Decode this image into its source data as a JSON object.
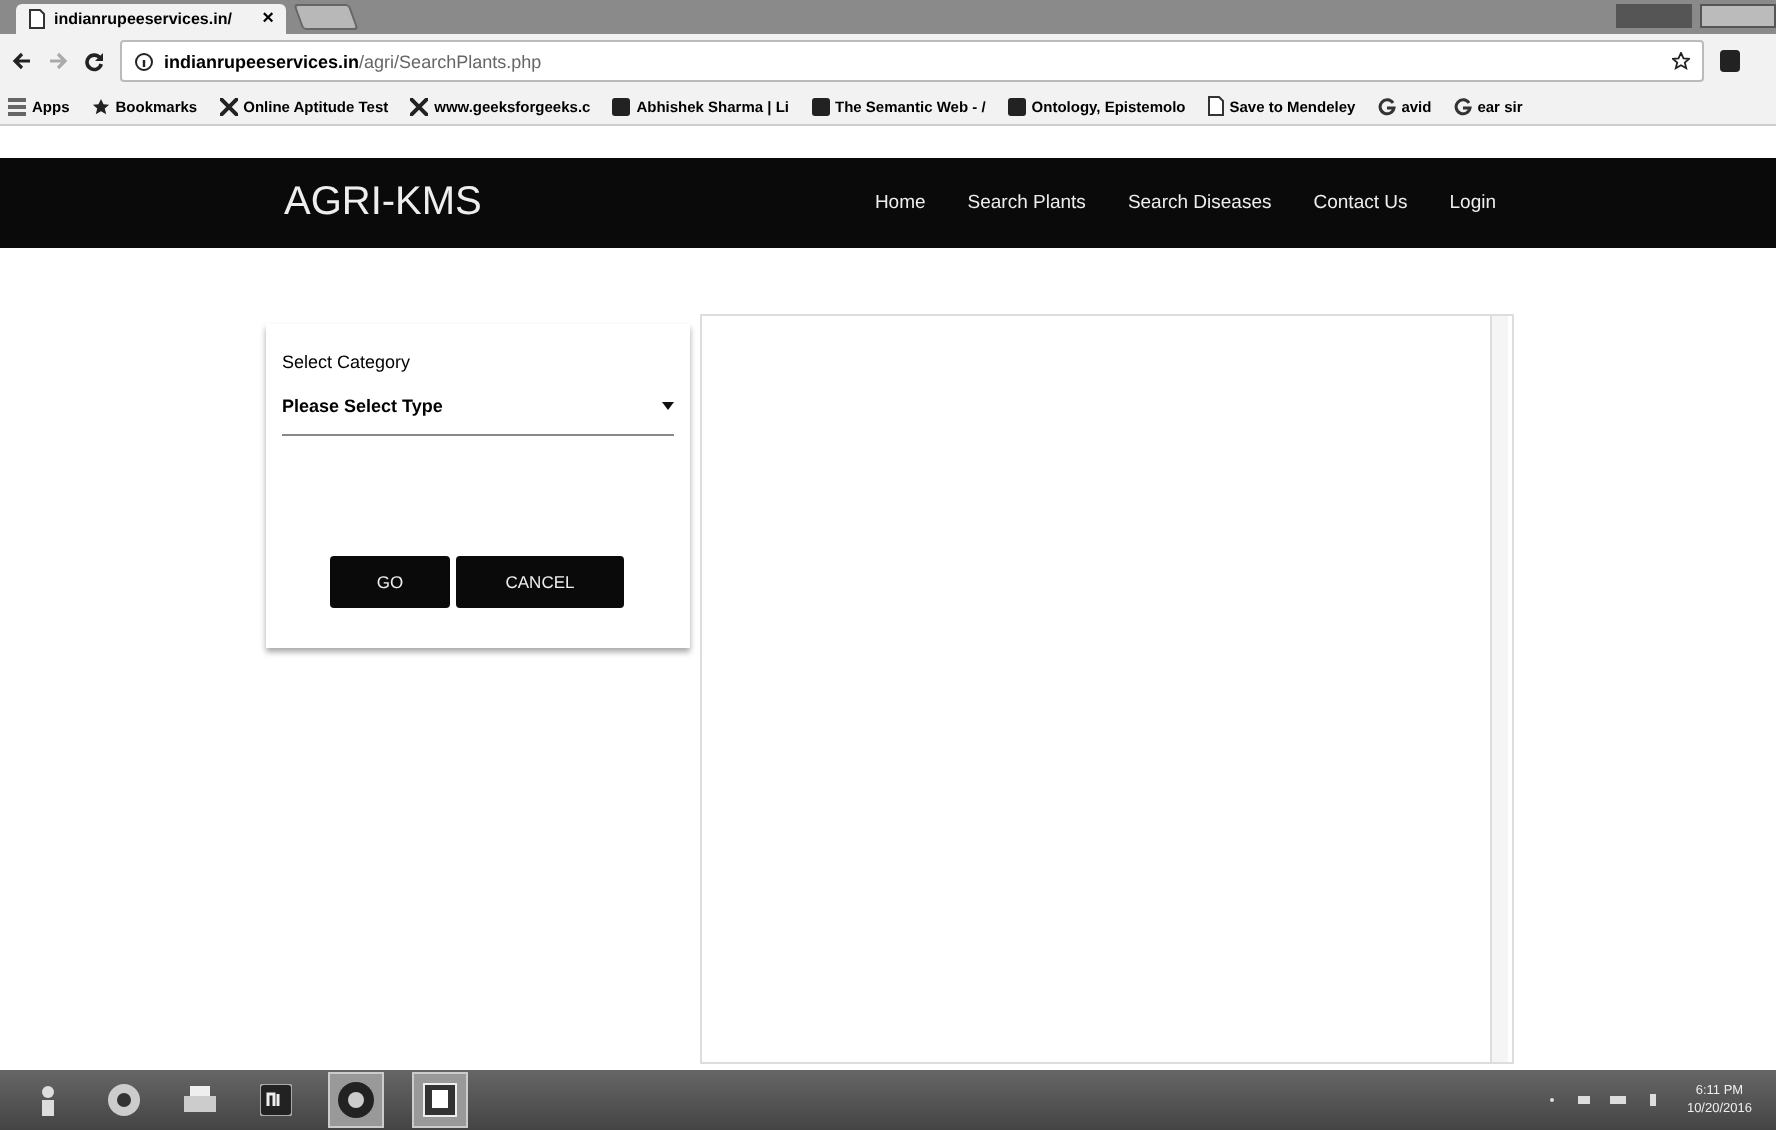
{
  "browser": {
    "tab_title": "indianrupeeservices.in/",
    "close": "×",
    "url_host": "indianrupeeservices.in",
    "url_path": "/agri/SearchPlants.php",
    "bookmarks": [
      {
        "label": "Apps",
        "kind": "apps"
      },
      {
        "label": "Bookmarks",
        "kind": "star"
      },
      {
        "label": "Online Aptitude Test",
        "kind": "site"
      },
      {
        "label": "www.geeksforgeeks.c",
        "kind": "site"
      },
      {
        "label": "Abhishek Sharma | Li",
        "kind": "box"
      },
      {
        "label": "The Semantic Web - /",
        "kind": "box"
      },
      {
        "label": "Ontology, Epistemolo",
        "kind": "box"
      },
      {
        "label": "Save to Mendeley",
        "kind": "page"
      },
      {
        "label": "avid",
        "kind": "google"
      },
      {
        "label": "ear sir",
        "kind": "google"
      }
    ]
  },
  "navbar": {
    "brand": "AGRI-KMS",
    "links": [
      "Home",
      "Search Plants",
      "Search Diseases",
      "Contact Us",
      "Login"
    ]
  },
  "form": {
    "label": "Select Category",
    "select_value": "Please Select Type",
    "buttons": [
      "GO",
      "CANCEL"
    ]
  },
  "taskbar": {
    "time": "6:11 PM",
    "date": "10/20/2016"
  }
}
